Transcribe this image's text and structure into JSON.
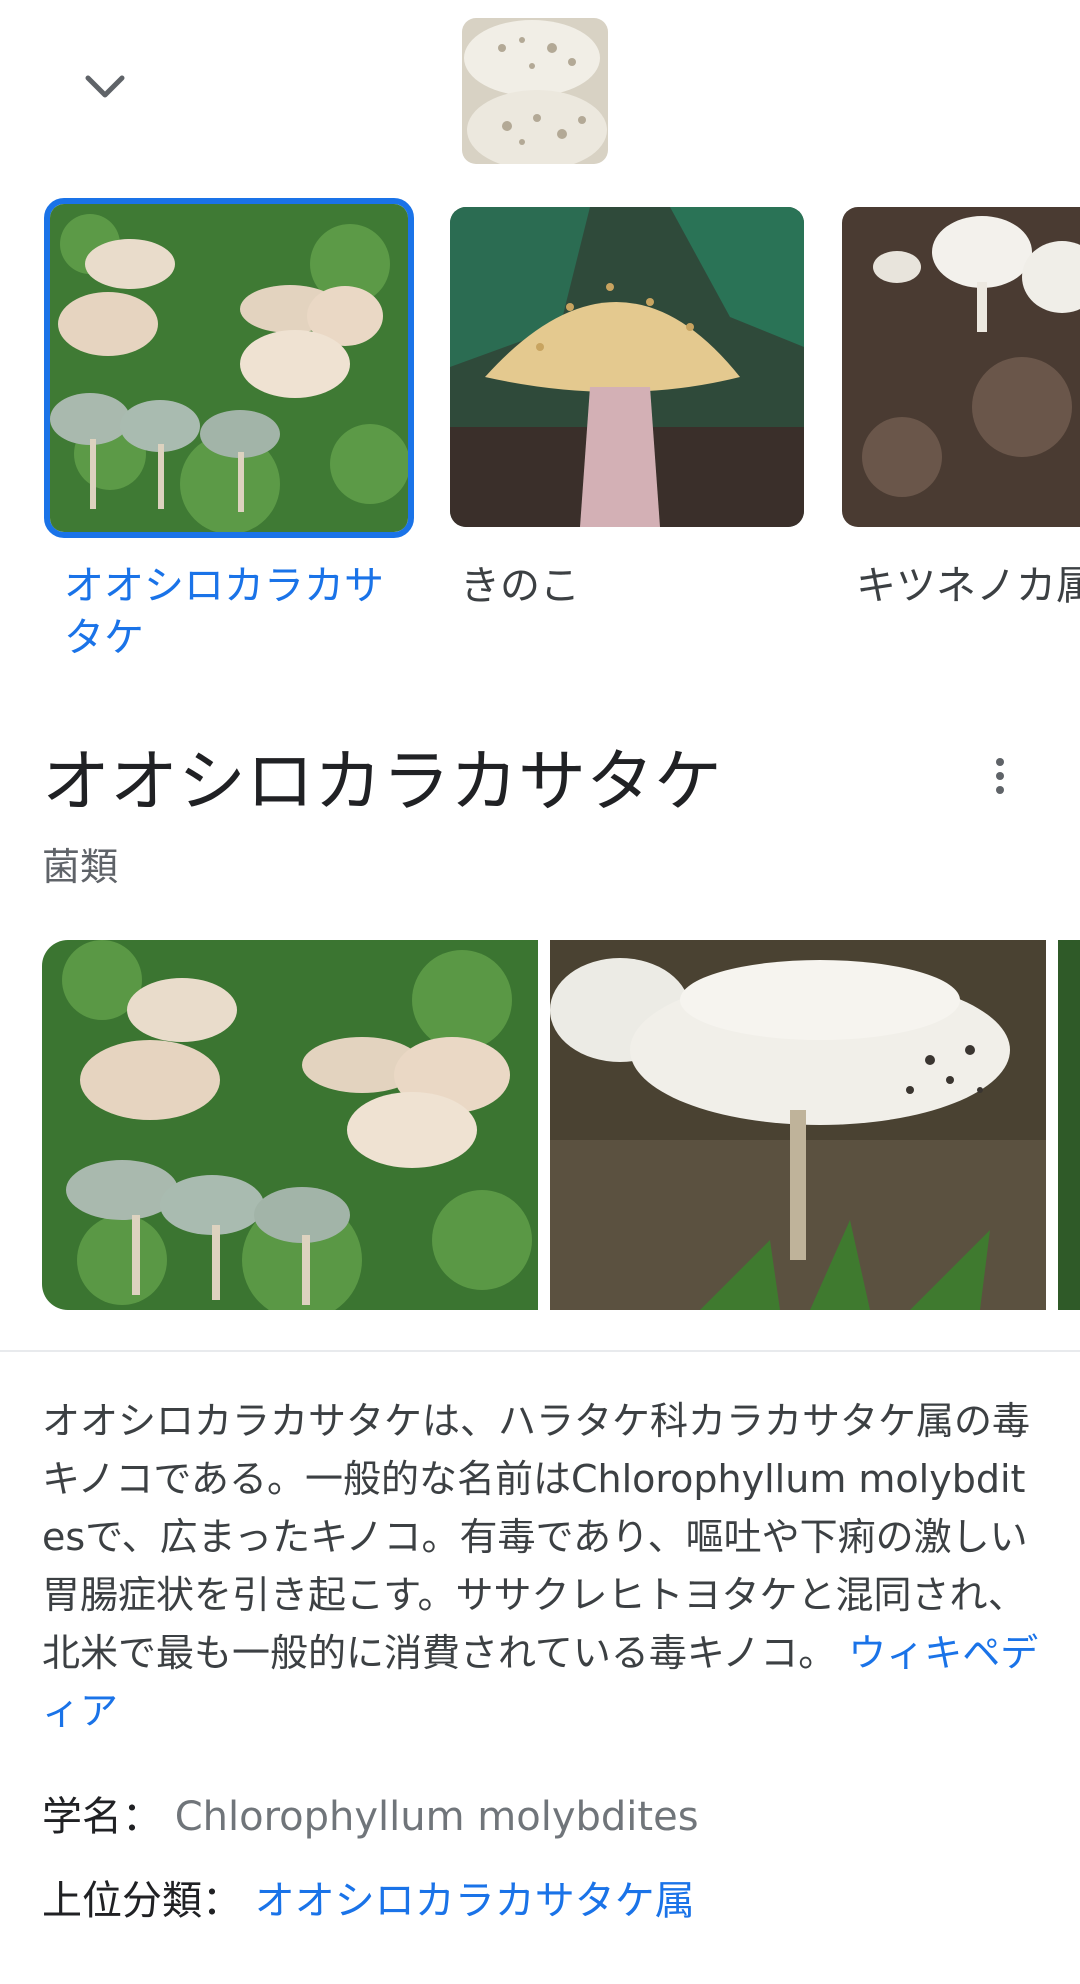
{
  "related": [
    {
      "label": "オオシロカラカサタケ",
      "selected": true
    },
    {
      "label": "きのこ",
      "selected": false
    },
    {
      "label": "キツネノカ属",
      "selected": false
    }
  ],
  "entity": {
    "title": "オオシロカラカサタケ",
    "subtitle": "菌類"
  },
  "description": {
    "text": "オオシロカラカサタケは、ハラタケ科カラカサタケ属の毒キノコである。一般的な名前はChlorophyllum molybditesで、広まったキノコ。有毒であり、嘔吐や下痢の激しい胃腸症状を引き起こす。ササクレヒトヨタケと混同され、北米で最も一般的に消費されている毒キノコ。",
    "source_link": "ウィキペディア"
  },
  "facts": {
    "scientific_name_label": "学名：",
    "scientific_name_value": "Chlorophyllum molybdites",
    "parent_taxon_label": "上位分類：",
    "parent_taxon_value": "オオシロカラカサタケ属"
  },
  "colors": {
    "accent": "#1a73e8",
    "text": "#202124",
    "muted": "#70757a"
  },
  "icons": {
    "collapse": "chevron-down-icon",
    "menu": "more-vert-icon"
  }
}
